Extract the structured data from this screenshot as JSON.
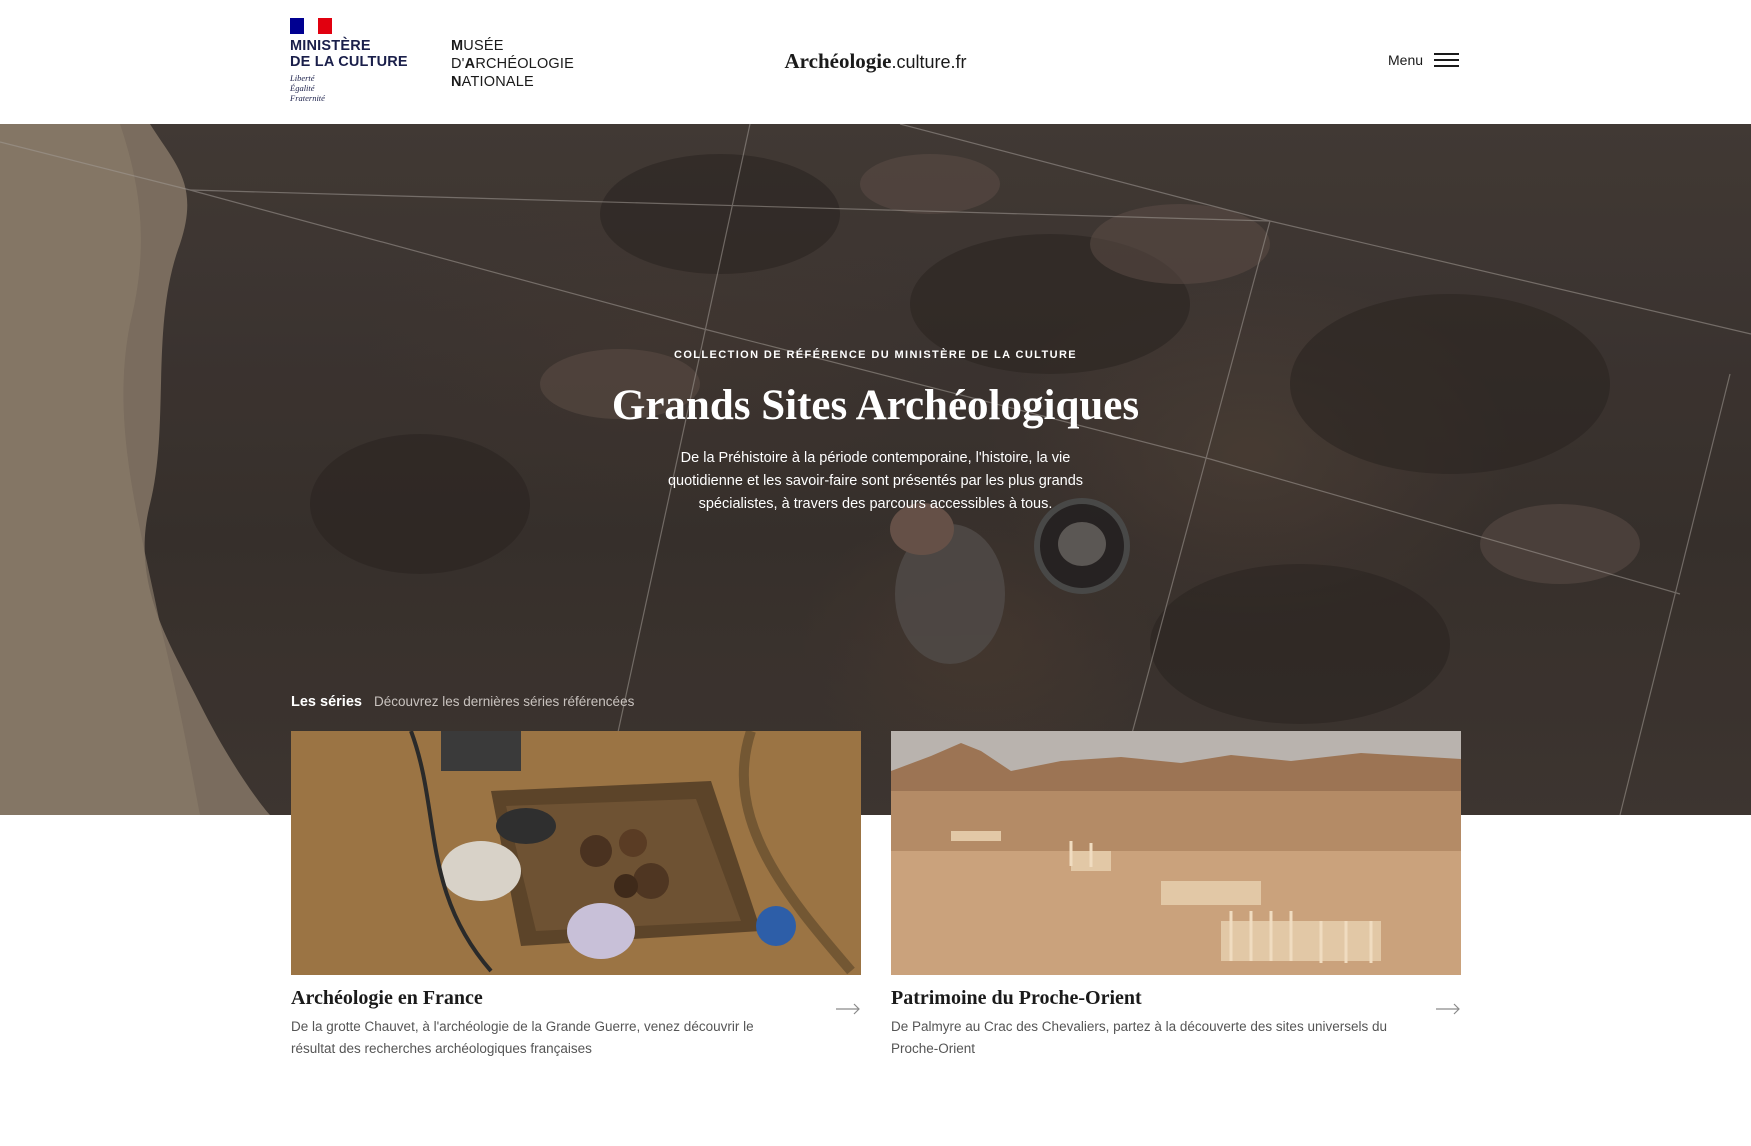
{
  "header": {
    "ministry_name_line1": "MINISTÈRE",
    "ministry_name_line2": "DE LA CULTURE",
    "motto_line1": "Liberté",
    "motto_line2": "Égalité",
    "motto_line3": "Fraternité",
    "museum_line1_initial": "M",
    "museum_line1_rest": "USÉE",
    "museum_line2_pre": "D'",
    "museum_line2_initial": "A",
    "museum_line2_rest": "RCHÉOLOGIE",
    "museum_line3_initial": "N",
    "museum_line3_rest": "ATIONALE",
    "site_logo_main": "Archéologie",
    "site_logo_sub": ".culture.fr",
    "menu_label": "Menu"
  },
  "hero": {
    "eyebrow": "COLLECTION DE RÉFÉRENCE DU MINISTÈRE DE LA CULTURE",
    "title": "Grands Sites Archéologiques",
    "description": "De la Préhistoire à la période contemporaine, l'histoire, la vie quotidienne et les savoir-faire sont présentés par les plus grands spécialistes, à travers des parcours accessibles à tous."
  },
  "series": {
    "title": "Les séries",
    "subtitle": "Découvrez les dernières séries référencées",
    "cards": [
      {
        "title": "Archéologie en France",
        "description": "De la grotte Chauvet, à l'archéologie de la Grande Guerre, venez découvrir le résultat des recherches archéologiques françaises"
      },
      {
        "title": "Patrimoine du Proche-Orient",
        "description": "De Palmyre au Crac des Chevaliers, partez à la découverte des sites universels du Proche-Orient"
      }
    ]
  },
  "colors": {
    "ministry_blue": "#1a1f4a",
    "flag_blue": "#000091",
    "flag_red": "#e1000f",
    "hero_overlay": "#3e3632"
  },
  "icons": [
    "hamburger-menu-icon",
    "arrow-right-icon"
  ]
}
